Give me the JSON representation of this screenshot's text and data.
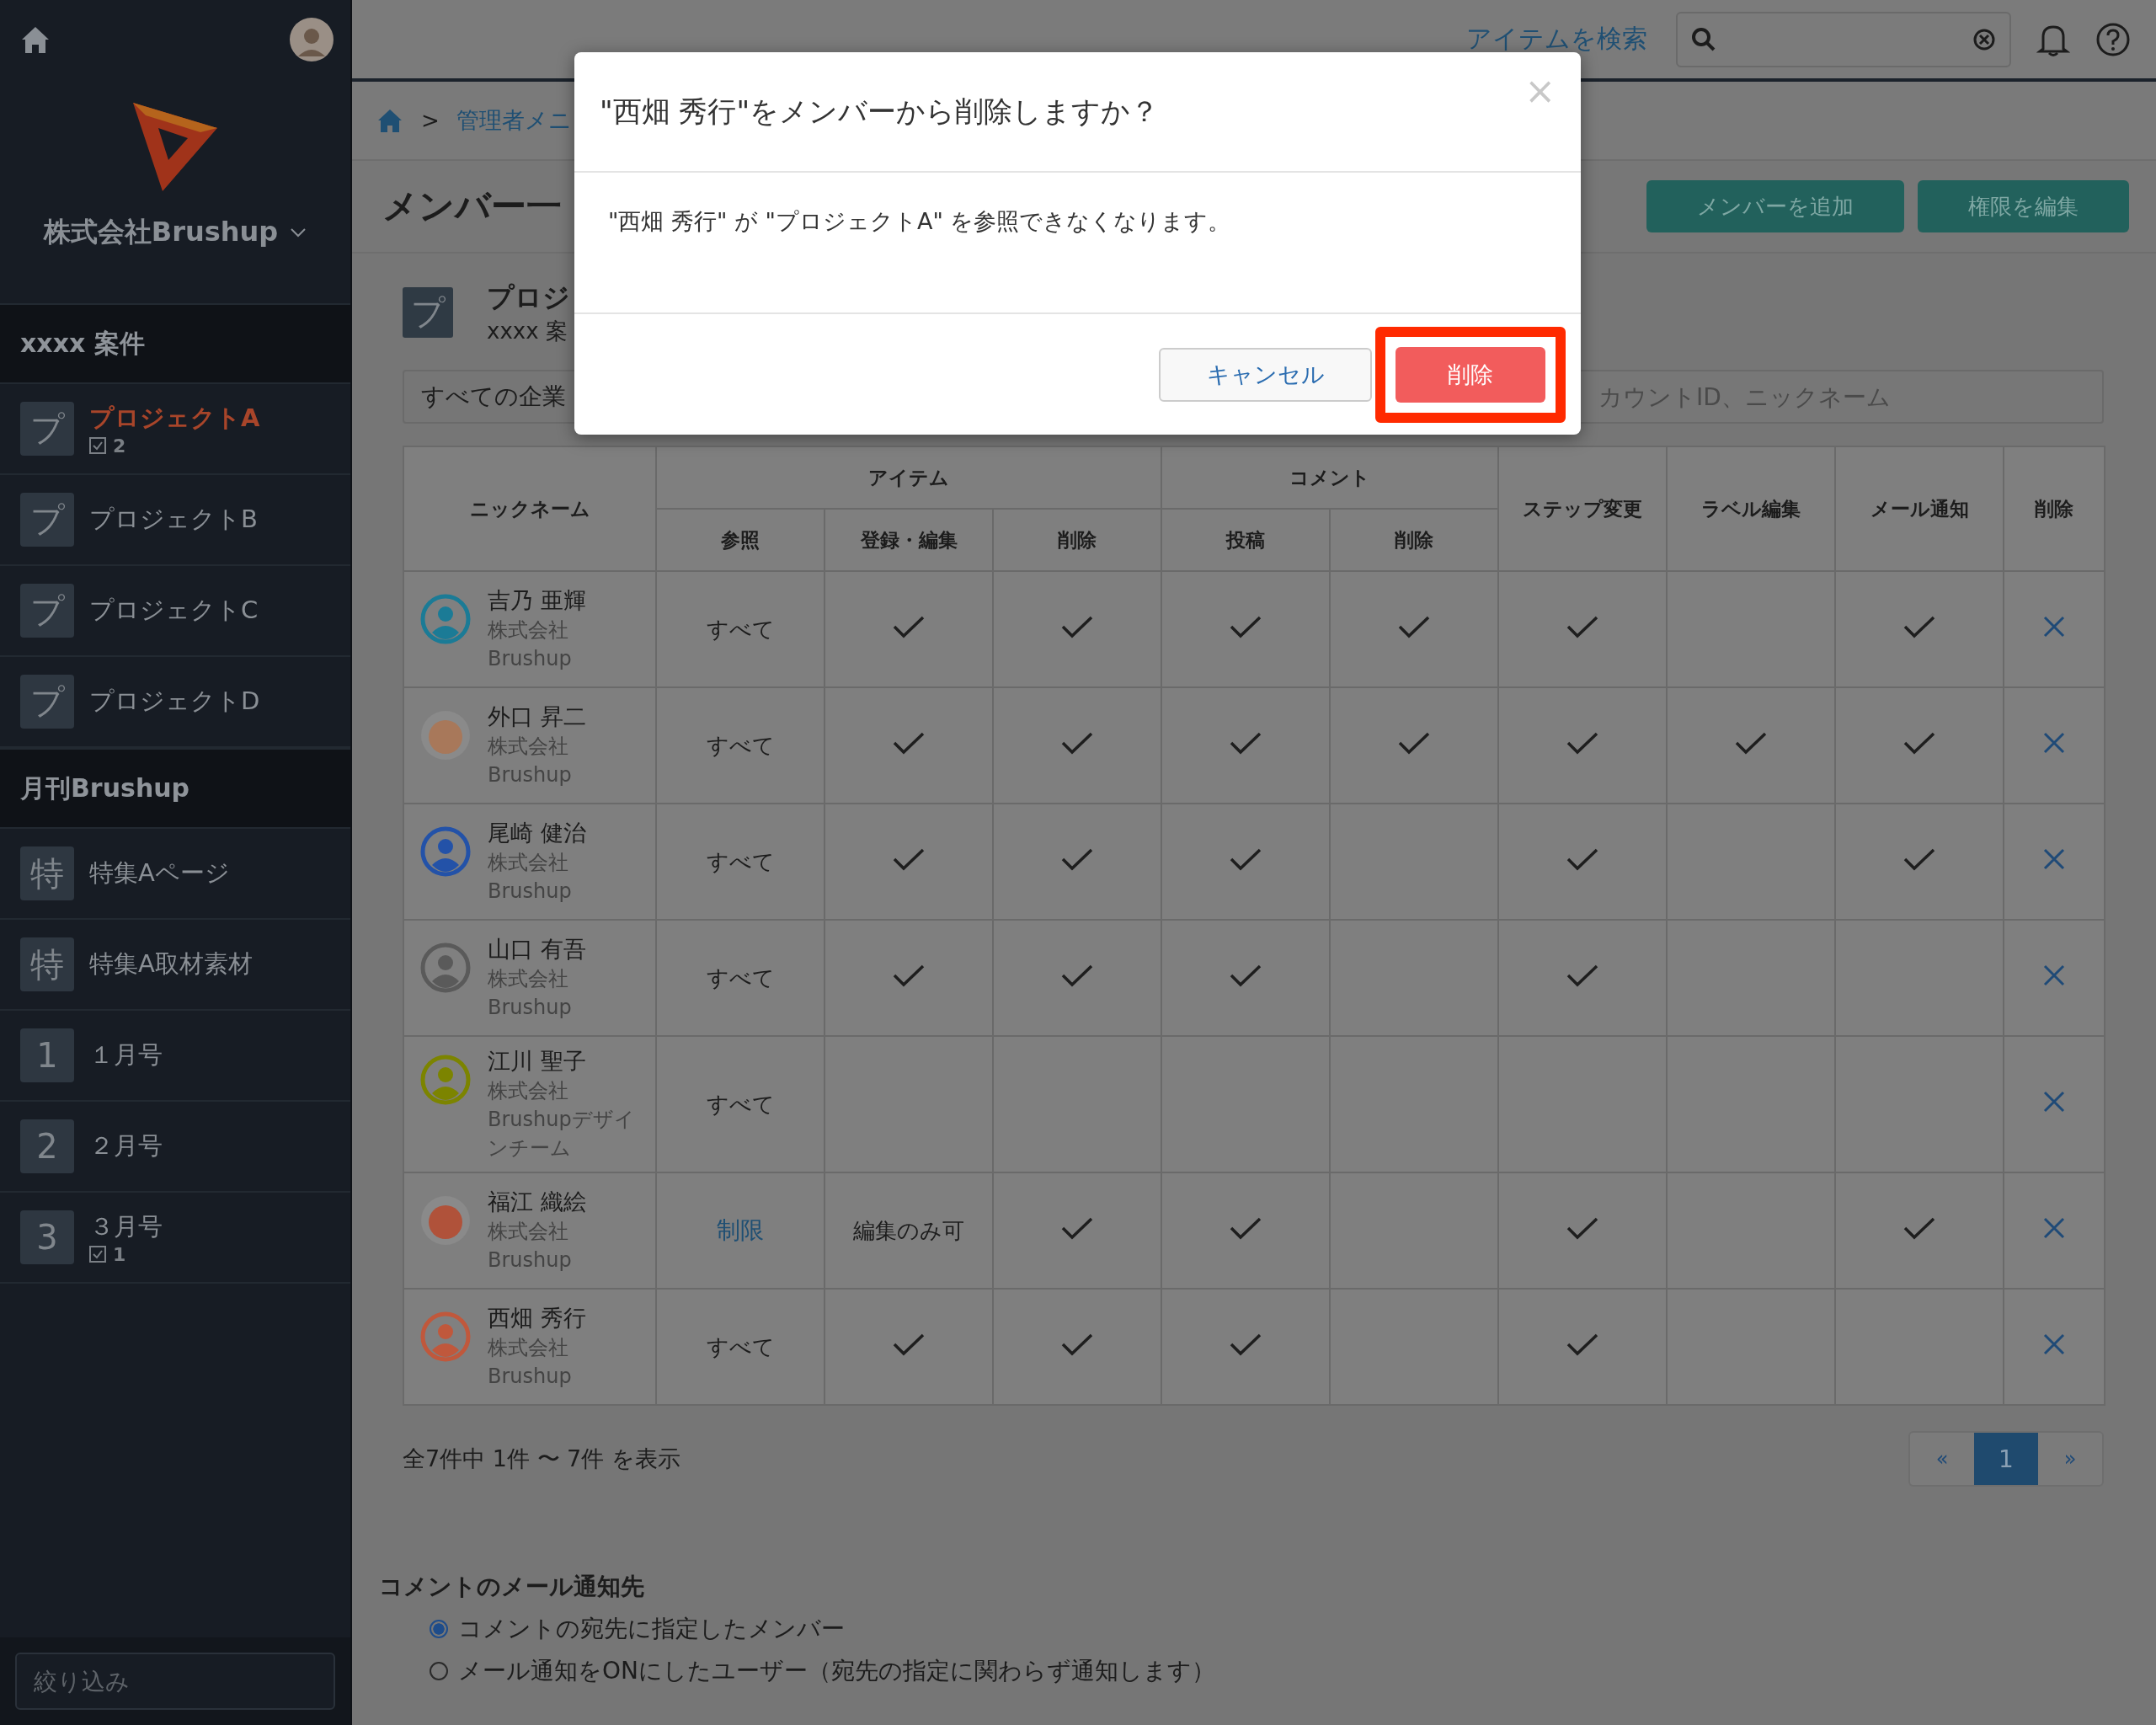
{
  "sidebar": {
    "company": "株式会社Brushup",
    "groups": [
      {
        "title": "xxxx 案件",
        "items": [
          {
            "icon": "プ",
            "label": "プロジェクトA",
            "selected": true,
            "count": "2"
          },
          {
            "icon": "プ",
            "label": "プロジェクトB",
            "selected": false
          },
          {
            "icon": "プ",
            "label": "プロジェクトC",
            "selected": false
          },
          {
            "icon": "プ",
            "label": "プロジェクトD",
            "selected": false
          }
        ]
      },
      {
        "title": "月刊Brushup",
        "items": [
          {
            "icon": "特",
            "label": "特集Aページ",
            "selected": false
          },
          {
            "icon": "特",
            "label": "特集A取材素材",
            "selected": false
          },
          {
            "icon": "1",
            "label": "１月号",
            "selected": false
          },
          {
            "icon": "2",
            "label": "２月号",
            "selected": false
          },
          {
            "icon": "3",
            "label": "３月号",
            "selected": false,
            "count": "1"
          }
        ]
      }
    ],
    "filter": {
      "placeholder": "絞り込み"
    }
  },
  "topbar": {
    "search_link": "アイテムを検索"
  },
  "breadcrumb": {
    "separator": ">",
    "item": "管理者メニ"
  },
  "title": "メンバー一",
  "actions": [
    "メンバーを追加",
    "権限を編集"
  ],
  "project": {
    "icon": "プ",
    "name": "プロジ",
    "sub": "xxxx 案"
  },
  "filters": {
    "company": "すべての企業",
    "search_placeholder": "カウントID、ニックネーム"
  },
  "table": {
    "header": [
      {
        "label": "ニックネーム"
      },
      {
        "label": "アイテム",
        "children": [
          "参照",
          "登録・編集",
          "削除"
        ]
      },
      {
        "label": "コメント",
        "children": [
          "投稿",
          "削除"
        ]
      },
      {
        "label": "ステップ変更"
      },
      {
        "label": "ラベル編集"
      },
      {
        "label": "メール通知"
      },
      {
        "label": "削除"
      }
    ],
    "rows": [
      {
        "name": "吉乃 亜輝",
        "company": [
          "株式会社",
          "Brushup"
        ],
        "avatar": {
          "kind": "silhouette",
          "color": "#1b7b96"
        },
        "cells": [
          {
            "kind": "text",
            "text": "すべて"
          },
          {
            "kind": "check",
            "checked": true
          },
          {
            "kind": "check",
            "checked": true
          },
          {
            "kind": "check",
            "checked": true
          },
          {
            "kind": "check",
            "checked": true
          },
          {
            "kind": "check",
            "checked": true
          },
          {
            "kind": "check",
            "checked": false
          },
          {
            "kind": "check",
            "checked": true
          }
        ]
      },
      {
        "name": "外口 昇二",
        "company": [
          "株式会社",
          "Brushup"
        ],
        "avatar": {
          "kind": "illustration",
          "color": "#a8785a"
        },
        "cells": [
          {
            "kind": "text",
            "text": "すべて"
          },
          {
            "kind": "check",
            "checked": true
          },
          {
            "kind": "check",
            "checked": true
          },
          {
            "kind": "check",
            "checked": true
          },
          {
            "kind": "check",
            "checked": true
          },
          {
            "kind": "check",
            "checked": true
          },
          {
            "kind": "check",
            "checked": true
          },
          {
            "kind": "check",
            "checked": true
          }
        ]
      },
      {
        "name": "尾崎 健治",
        "company": [
          "株式会社",
          "Brushup"
        ],
        "avatar": {
          "kind": "silhouette",
          "color": "#2352a8"
        },
        "cells": [
          {
            "kind": "text",
            "text": "すべて"
          },
          {
            "kind": "check",
            "checked": true
          },
          {
            "kind": "check",
            "checked": true
          },
          {
            "kind": "check",
            "checked": true
          },
          {
            "kind": "check",
            "checked": false
          },
          {
            "kind": "check",
            "checked": true
          },
          {
            "kind": "check",
            "checked": false
          },
          {
            "kind": "check",
            "checked": true
          }
        ]
      },
      {
        "name": "山口 有吾",
        "company": [
          "株式会社",
          "Brushup"
        ],
        "avatar": {
          "kind": "silhouette",
          "color": "#5a5a5a"
        },
        "cells": [
          {
            "kind": "text",
            "text": "すべて"
          },
          {
            "kind": "check",
            "checked": true
          },
          {
            "kind": "check",
            "checked": true
          },
          {
            "kind": "check",
            "checked": true
          },
          {
            "kind": "check",
            "checked": false
          },
          {
            "kind": "check",
            "checked": true
          },
          {
            "kind": "check",
            "checked": false
          },
          {
            "kind": "check",
            "checked": false
          }
        ]
      },
      {
        "name": "江川 聖子",
        "company": [
          "株式会社",
          "Brushupデザインチーム"
        ],
        "avatar": {
          "kind": "silhouette",
          "color": "#7c8400"
        },
        "cells": [
          {
            "kind": "text",
            "text": "すべて"
          },
          {
            "kind": "check",
            "checked": false
          },
          {
            "kind": "check",
            "checked": false
          },
          {
            "kind": "check",
            "checked": false
          },
          {
            "kind": "check",
            "checked": false
          },
          {
            "kind": "check",
            "checked": false
          },
          {
            "kind": "check",
            "checked": false
          },
          {
            "kind": "check",
            "checked": false
          }
        ]
      },
      {
        "name": "福江 織絵",
        "company": [
          "株式会社",
          "Brushup"
        ],
        "avatar": {
          "kind": "illustration",
          "color": "#b0523a"
        },
        "cells": [
          {
            "kind": "link",
            "text": "制限"
          },
          {
            "kind": "text",
            "text": "編集のみ可"
          },
          {
            "kind": "check",
            "checked": true
          },
          {
            "kind": "check",
            "checked": true
          },
          {
            "kind": "check",
            "checked": false
          },
          {
            "kind": "check",
            "checked": true
          },
          {
            "kind": "check",
            "checked": false
          },
          {
            "kind": "check",
            "checked": true
          }
        ]
      },
      {
        "name": "西畑 秀行",
        "company": [
          "株式会社",
          "Brushup"
        ],
        "avatar": {
          "kind": "silhouette",
          "color": "#c0583c"
        },
        "cells": [
          {
            "kind": "text",
            "text": "すべて"
          },
          {
            "kind": "check",
            "checked": true
          },
          {
            "kind": "check",
            "checked": true
          },
          {
            "kind": "check",
            "checked": true
          },
          {
            "kind": "check",
            "checked": false
          },
          {
            "kind": "check",
            "checked": true
          },
          {
            "kind": "check",
            "checked": false
          },
          {
            "kind": "check",
            "checked": false
          }
        ]
      }
    ]
  },
  "summary": "全7件中 1件 〜 7件 を表示",
  "pager": {
    "prev": "«",
    "pages": [
      {
        "label": "1",
        "selected": true
      }
    ],
    "next": "»"
  },
  "notify": {
    "title": "コメントのメール通知先",
    "options": [
      {
        "label": "コメントの宛先に指定したメンバー",
        "selected": true
      },
      {
        "label": "メール通知をONにしたユーザー（宛先の指定に関わらず通知します）",
        "selected": false
      }
    ]
  },
  "modal": {
    "title": "\"西畑 秀行\"をメンバーから削除しますか？",
    "close": "×",
    "body": "\"西畑 秀行\" が \"プロジェクトA\" を参照できなくなります。",
    "cancel": "キャンセル",
    "confirm": "削除",
    "confirm_highlighted": true
  }
}
